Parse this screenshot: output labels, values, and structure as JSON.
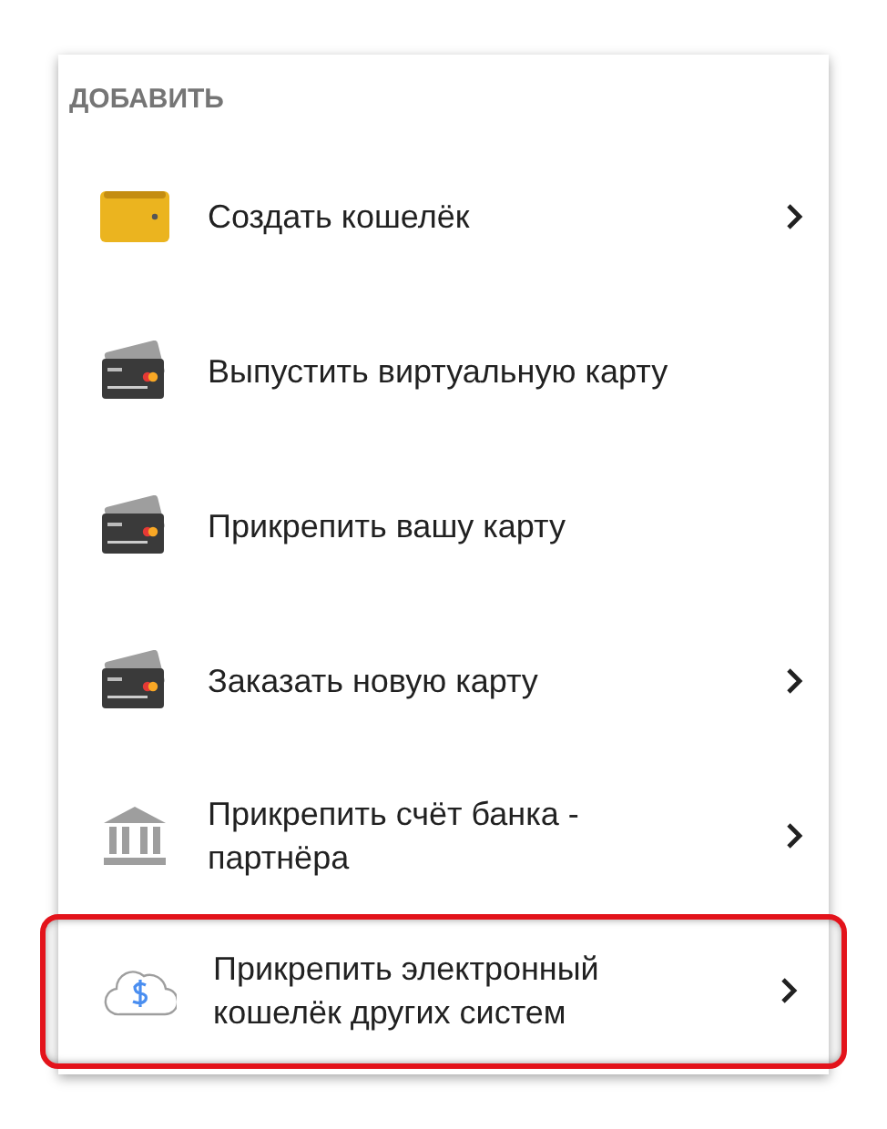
{
  "section": {
    "title": "ДОБАВИТЬ"
  },
  "items": [
    {
      "kind": "wallet",
      "label": "Создать кошелёк",
      "chevron": true,
      "highlighted": false
    },
    {
      "kind": "card",
      "label": "Выпустить виртуальную карту",
      "chevron": false,
      "highlighted": false
    },
    {
      "kind": "card",
      "label": "Прикрепить вашу карту",
      "chevron": false,
      "highlighted": false
    },
    {
      "kind": "card",
      "label": "Заказать новую карту",
      "chevron": true,
      "highlighted": false
    },
    {
      "kind": "bank",
      "label": "Прикрепить счёт банка - партнёра",
      "chevron": true,
      "highlighted": false
    },
    {
      "kind": "cloud",
      "label": "Прикрепить электронный кошелёк других систем",
      "chevron": true,
      "highlighted": true
    }
  ]
}
